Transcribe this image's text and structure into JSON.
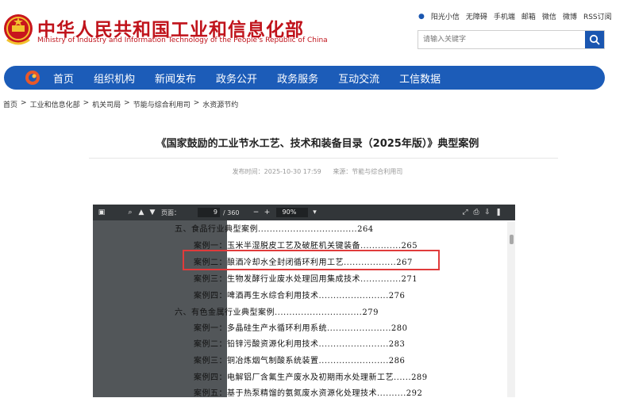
{
  "header": {
    "site_title": "中华人民共和国工业和信息化部",
    "site_subtitle": "Ministry of Industry and Information Technology of the People's Republic of China",
    "top_links": [
      "阳光小信",
      "无障碍",
      "手机端",
      "邮箱",
      "微信",
      "微博",
      "RSS订阅"
    ],
    "search_placeholder": "请输入关键字"
  },
  "nav": {
    "items": [
      "首页",
      "组织机构",
      "新闻发布",
      "政务公开",
      "政务服务",
      "互动交流",
      "工信数据"
    ]
  },
  "breadcrumb": [
    "首页",
    "工业和信息化部",
    "机关司局",
    "节能与综合利用司",
    "水资源节约"
  ],
  "breadcrumb_sep": ">",
  "article": {
    "title": "《国家鼓励的工业节水工艺、技术和装备目录（2025年版）》典型案例",
    "publish_time": "发布时间：2025-10-30 17:59",
    "source": "来源：节能与综合利用司"
  },
  "pdf_viewer": {
    "page_label": "页面：",
    "current_page": "9",
    "total_pages": "/ 360",
    "zoom": "90%",
    "toc": [
      "五、食品行业典型案例..................................264",
      "案例一：玉米半湿脱皮工艺及破胚机关键装备..............265",
      "案例二：酿酒冷却水全封闭循环利用工艺..................267",
      "案例三：生物发酵行业废水处理回用集成技术..............271",
      "案例四：啤酒再生水综合利用技术........................276",
      "六、有色金属行业典型案例..............................279",
      "案例一：多晶硅生产水循环利用系统......................280",
      "案例二：铅锌污酸资源化利用技术........................283",
      "案例三：铜冶炼烟气制酸系统装置........................286",
      "案例四：电解铝厂含氟生产废水及初期雨水处理新工艺......289",
      "案例五：基于热泵精馏的氨氮废水资源化处理技术..........292"
    ]
  },
  "colors": {
    "brand_red": "#c0131b",
    "nav_blue": "#1c5cb8",
    "highlight_red": "#e03b3b"
  }
}
